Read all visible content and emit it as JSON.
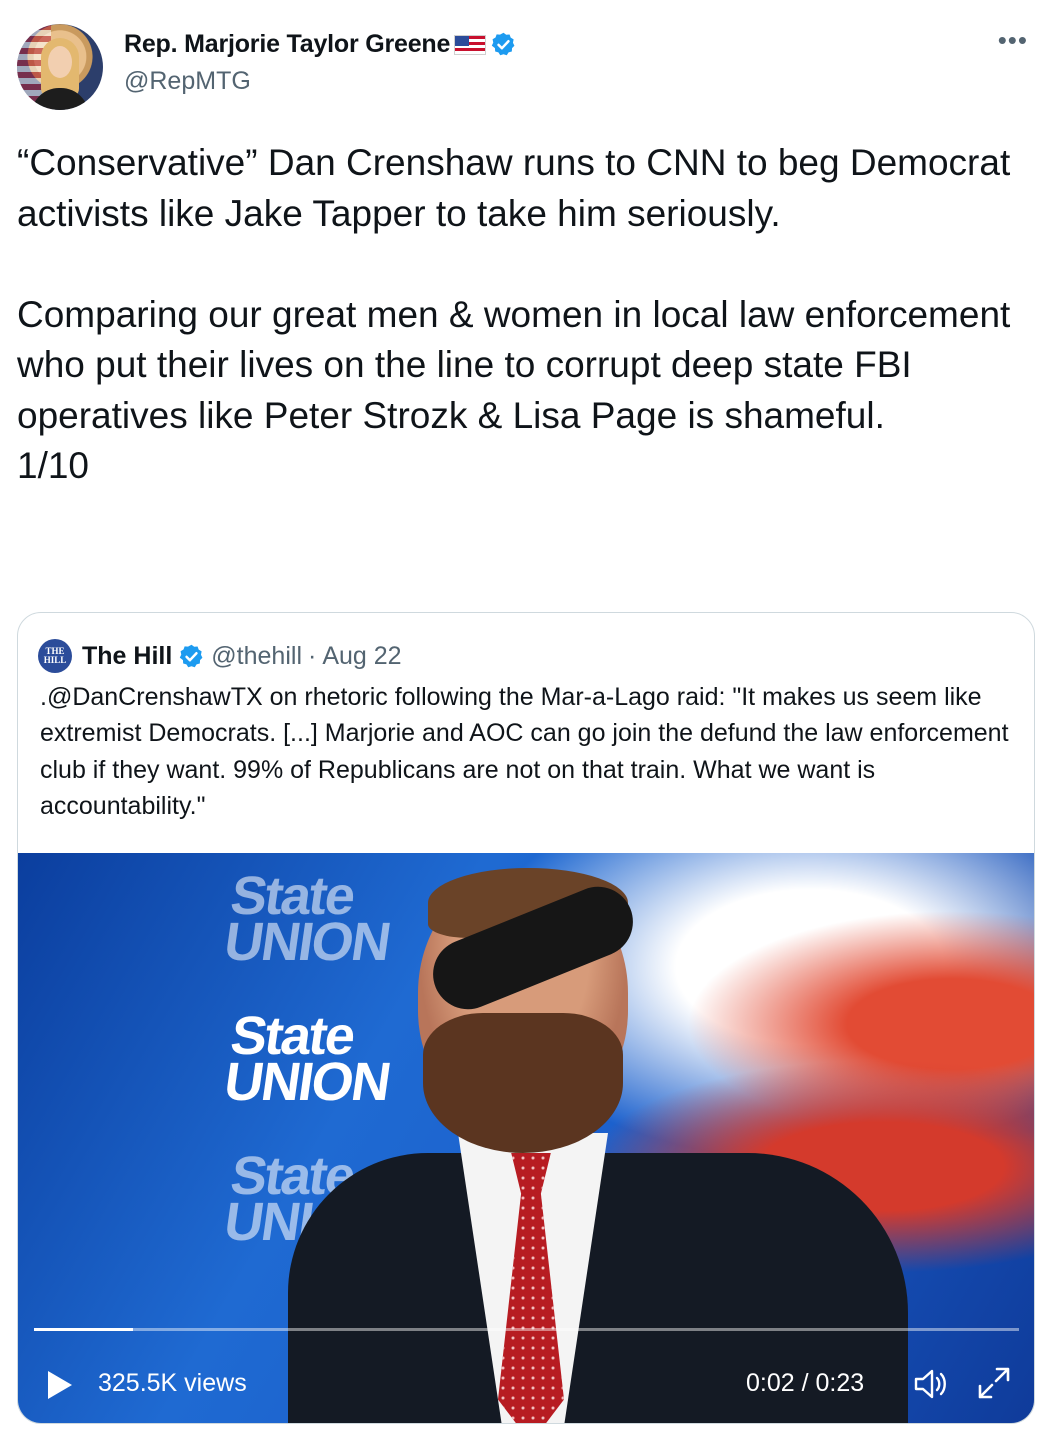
{
  "author": {
    "display_name": "Rep. Marjorie Taylor Greene",
    "handle": "@RepMTG",
    "flag_icon": "us-flag-icon",
    "verified": true
  },
  "tweet": {
    "text": "“Conservative” Dan Crenshaw runs to CNN to beg Democrat activists like Jake Tapper to take him seriously.\n\nComparing our great men & women in local law enforcement who put their lives on the line to corrupt deep state FBI operatives like Peter Strozk & Lisa Page is shameful.\n1/10"
  },
  "quoted_tweet": {
    "display_name": "The Hill",
    "logo_text": "THE HILL",
    "handle": "@thehill",
    "separator": "·",
    "date": "Aug 22",
    "text": ".@DanCrenshawTX on rhetoric following the Mar-a-Lago raid: \"It makes us seem like extremist Democrats. [...] Marjorie and AOC can go join the defund the law enforcement club if they want. 99% of Republicans are not on that train. What we want is accountability.\"",
    "video": {
      "views": "325.5K views",
      "time": "0:02 / 0:23",
      "progress": 0.1,
      "logo_lines": [
        "State",
        "UNION"
      ]
    }
  },
  "colors": {
    "verified": "#1d9bf0",
    "secondary_text": "#536471",
    "border": "#cfd9de"
  }
}
